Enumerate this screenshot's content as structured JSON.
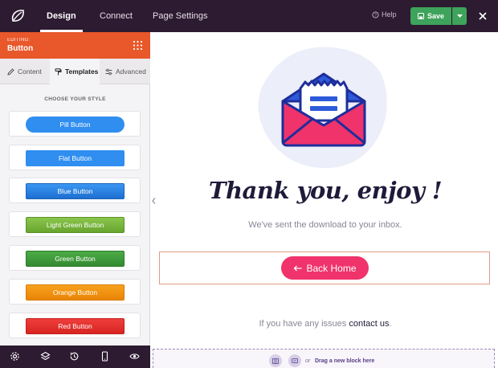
{
  "topbar": {
    "tabs": [
      {
        "label": "Design"
      },
      {
        "label": "Connect"
      },
      {
        "label": "Page Settings"
      }
    ],
    "help_label": "Help",
    "save_label": "Save",
    "background": "#2d1b31"
  },
  "sidebar": {
    "editing_label": "EDITING:",
    "editing_title": "Button",
    "subtabs": [
      {
        "label": "Content"
      },
      {
        "label": "Templates"
      },
      {
        "label": "Advanced"
      }
    ],
    "section_title": "CHOOSE YOUR STYLE",
    "styles": [
      {
        "label": "Pill Button",
        "color": "#2f8ef0"
      },
      {
        "label": "Flat Button",
        "color": "#2f8ef0"
      },
      {
        "label": "Blue Button",
        "color": "#2080e0"
      },
      {
        "label": "Light Green Button",
        "color": "#79b63c"
      },
      {
        "label": "Green Button",
        "color": "#3f9a3b"
      },
      {
        "label": "Orange Button",
        "color": "#f1930c"
      },
      {
        "label": "Red Button",
        "color": "#e5312f"
      }
    ],
    "accent": "#e8582a"
  },
  "canvas": {
    "heading": "Thank you, enjoy !",
    "subtext": "We've sent the download to your inbox.",
    "button_label": "Back Home",
    "button_color": "#f0336b",
    "issues_text": "If you have any issues",
    "contact_link": "contact us",
    "period": ".",
    "drop_or": "or",
    "drop_text": "Drag a new block here"
  }
}
